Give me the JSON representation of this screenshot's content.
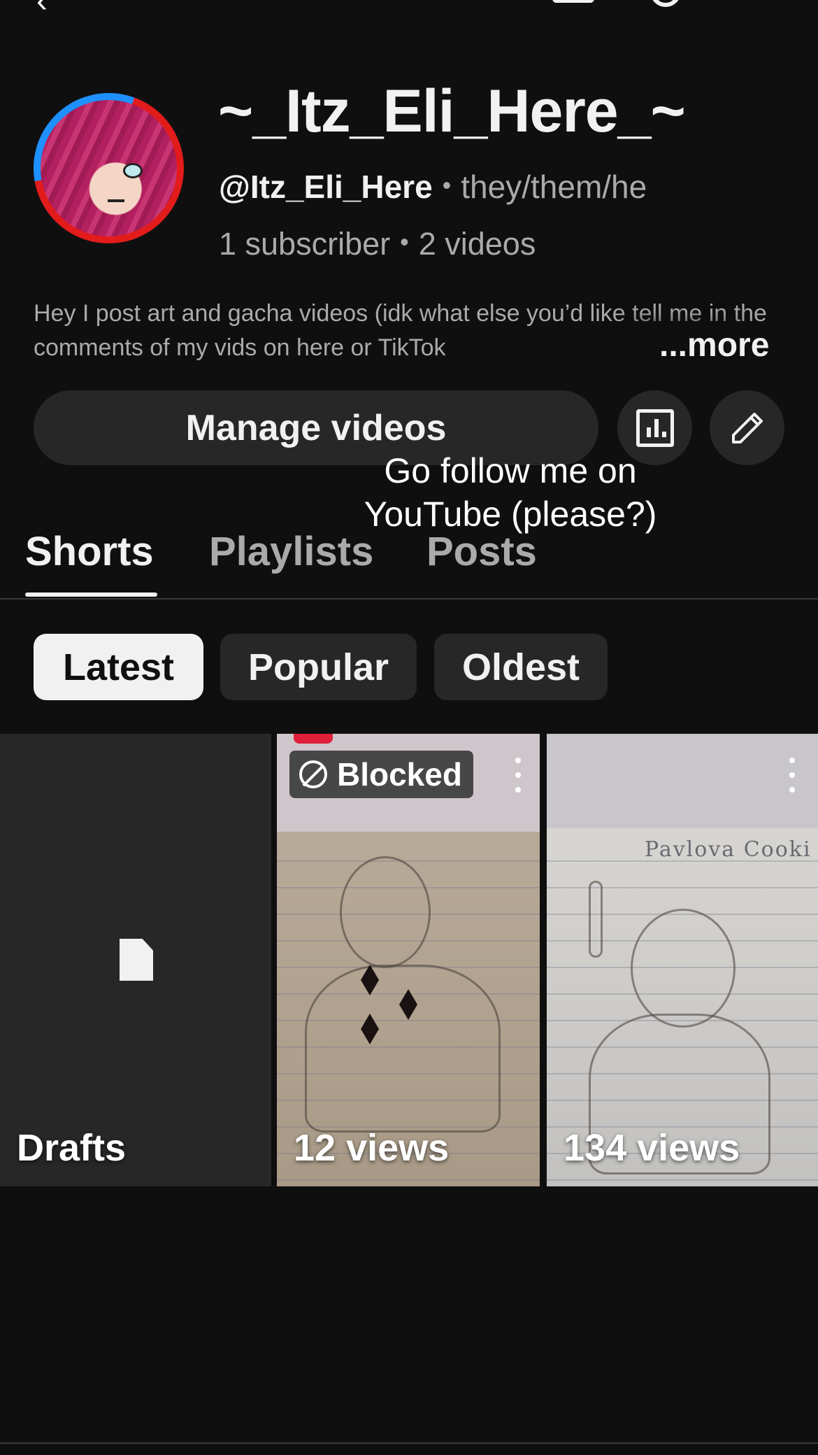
{
  "topbar": {
    "back_icon": "arrow-back-icon",
    "cast_icon": "cast-icon",
    "search_icon": "search-icon",
    "more_icon": "more-vert-icon"
  },
  "channel": {
    "name": "~_Itz_Eli_Here_~",
    "handle": "@Itz_Eli_Here",
    "pronouns": "they/them/he",
    "subscribers": "1 subscriber",
    "videos": "2 videos",
    "separator": "•",
    "description": "Hey I post art and gacha videos (idk what else you’d like tell me in the comments of my vids on here or TikTok",
    "more_label": "...more"
  },
  "actions": {
    "manage_label": "Manage videos",
    "analytics_icon": "analytics-icon",
    "edit_icon": "pencil-icon"
  },
  "overlay_text": "Go follow me on YouTube (please?)",
  "tabs": [
    {
      "label": "Shorts",
      "active": true
    },
    {
      "label": "Playlists",
      "active": false
    },
    {
      "label": "Posts",
      "active": false
    }
  ],
  "chips": [
    {
      "label": "Latest",
      "active": true
    },
    {
      "label": "Popular",
      "active": false
    },
    {
      "label": "Oldest",
      "active": false
    }
  ],
  "grid": {
    "drafts_label": "Drafts",
    "items": [
      {
        "views": "12 views",
        "badge": "Blocked"
      },
      {
        "views": "134 views",
        "paper_text": "Pavlova Cooki"
      }
    ]
  },
  "colors": {
    "background": "#0f0f0f",
    "surface": "#272727",
    "text": "#f1f1f1",
    "secondary": "#aaaaaa"
  }
}
